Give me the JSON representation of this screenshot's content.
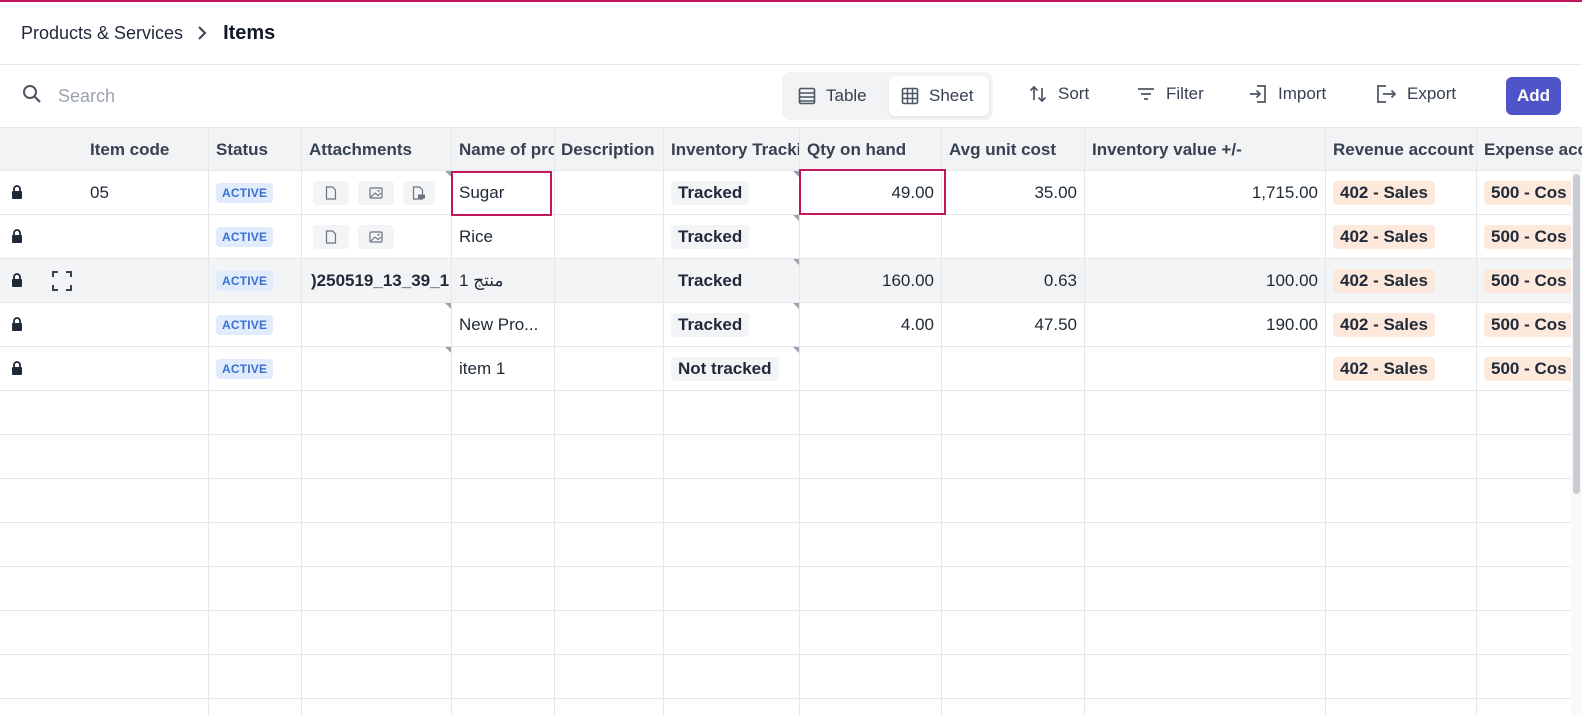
{
  "breadcrumb": {
    "parent": "Products & Services",
    "current": "Items"
  },
  "search": {
    "placeholder": "Search",
    "value": ""
  },
  "view_toggle": {
    "table_label": "Table",
    "sheet_label": "Sheet",
    "active": "Sheet"
  },
  "toolbar": {
    "sort_label": "Sort",
    "filter_label": "Filter",
    "import_label": "Import",
    "export_label": "Export",
    "add_label": "Add"
  },
  "columns": [
    "Item code",
    "Status",
    "Attachments",
    "Name of pro",
    "Description",
    "Inventory Trackir",
    "Qty on hand",
    "Avg unit cost",
    "Inventory value +/-",
    "Revenue account",
    "Expense acc"
  ],
  "rows": [
    {
      "item_code": "05",
      "status": "ACTIVE",
      "attachments": [
        "file-icon",
        "image-icon",
        "pdf-icon"
      ],
      "name": "Sugar",
      "description": "",
      "tracking": "Tracked",
      "qty": "49.00",
      "avg_cost": "35.00",
      "inv_value": "1,715.00",
      "revenue": "402 - Sales",
      "expense": "500 - Cos"
    },
    {
      "item_code": "",
      "status": "ACTIVE",
      "attachments": [
        "file-icon",
        "image-icon"
      ],
      "name": "Rice",
      "description": "",
      "tracking": "Tracked",
      "qty": "",
      "avg_cost": "",
      "inv_value": "",
      "revenue": "402 - Sales",
      "expense": "500 - Cos"
    },
    {
      "item_code": "",
      "status": "ACTIVE",
      "attachments_text": ")250519_13_39_1",
      "name": "منتج 1",
      "description": "",
      "tracking": "Tracked",
      "qty": "160.00",
      "avg_cost": "0.63",
      "inv_value": "100.00",
      "revenue": "402 - Sales",
      "expense": "500 - Cos"
    },
    {
      "item_code": "",
      "status": "ACTIVE",
      "name": "New Pro...",
      "description": "",
      "tracking": "Tracked",
      "qty": "4.00",
      "avg_cost": "47.50",
      "inv_value": "190.00",
      "revenue": "402 - Sales",
      "expense": "500 - Cos"
    },
    {
      "item_code": "",
      "status": "ACTIVE",
      "name": "item 1",
      "description": "",
      "tracking": "Not tracked",
      "qty": "",
      "avg_cost": "",
      "inv_value": "",
      "revenue": "402 - Sales",
      "expense": "500 - Cos"
    }
  ],
  "colors": {
    "accent": "#4f55c9",
    "selection": "#c2185b",
    "status_badge_bg": "#e0ecfb",
    "status_badge_fg": "#3b6fd4",
    "account_tag_bg": "#fde8dc"
  }
}
